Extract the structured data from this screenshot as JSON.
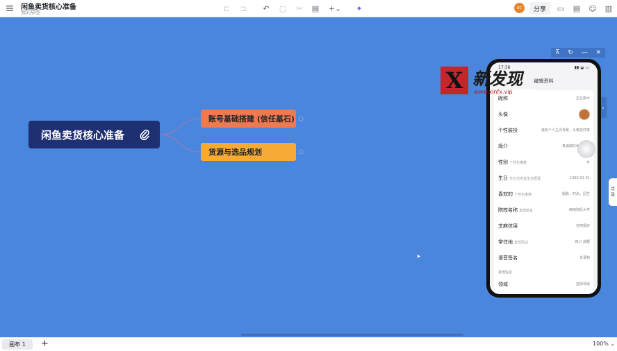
{
  "app": {
    "doc_title": "闲鱼卖货核心准备",
    "doc_subtitle": "我的导图"
  },
  "toolbar": {
    "tools": [
      "undo-icon",
      "redo-icon",
      "format-icon",
      "image-icon",
      "scissors-icon",
      "comment-icon",
      "insert-icon",
      "ai-sparkle-icon"
    ],
    "avatar_text": "OC",
    "share_label": "分享",
    "right_icons": [
      "present-icon",
      "comment-panel-icon",
      "smile-icon",
      "layout-icon"
    ]
  },
  "mindmap": {
    "root": "闲鱼卖货核心准备",
    "branches": [
      {
        "label": "账号基础搭建 (信任基石)",
        "color": "#f07a4f"
      },
      {
        "label": "货源与选品规划",
        "color": "#f7ab35"
      }
    ]
  },
  "float_controls": [
    "pin-icon",
    "history-icon",
    "minimize-icon",
    "close-icon"
  ],
  "phone": {
    "time": "17:38",
    "title": "编辑资料",
    "rows": [
      {
        "label": "昵称",
        "hint": "",
        "value": "正在做大"
      },
      {
        "label": "头像",
        "hint": "",
        "value": ""
      },
      {
        "label": "个性装扮",
        "hint": "",
        "value": "装扮个人主页背景、头像挂件等"
      },
      {
        "label": "简介",
        "hint": "",
        "value": "真诚做好每一件事"
      },
      {
        "label": "性别",
        "hint": "个性化推荐",
        "value": "女"
      },
      {
        "label": "生日",
        "hint": "生日当天送生日祝福",
        "value": "1990-01-31"
      },
      {
        "label": "喜欢的",
        "hint": "个性化推荐",
        "value": "摄影、时尚、园艺"
      },
      {
        "label": "院校名称",
        "hint": "发现校友",
        "value": "西南财经大学"
      },
      {
        "label": "芝麻信用",
        "hint": "",
        "value": "信用极好"
      },
      {
        "label": "常住地",
        "hint": "发现周边",
        "value": "四川 成都"
      },
      {
        "label": "语音签名",
        "hint": "",
        "value": "去录制"
      }
    ],
    "section_note": "其他信息",
    "last_row": {
      "label": "领域",
      "value": "选择领域"
    }
  },
  "side_tab": [
    "点",
    "导"
  ],
  "watermark": {
    "letter": "X",
    "big": "新发现",
    "url": "www.xinfx.vip",
    "name": "资源网"
  },
  "bottom": {
    "canvas_tab": "画布 1",
    "add": "+",
    "zoom": "100%"
  }
}
